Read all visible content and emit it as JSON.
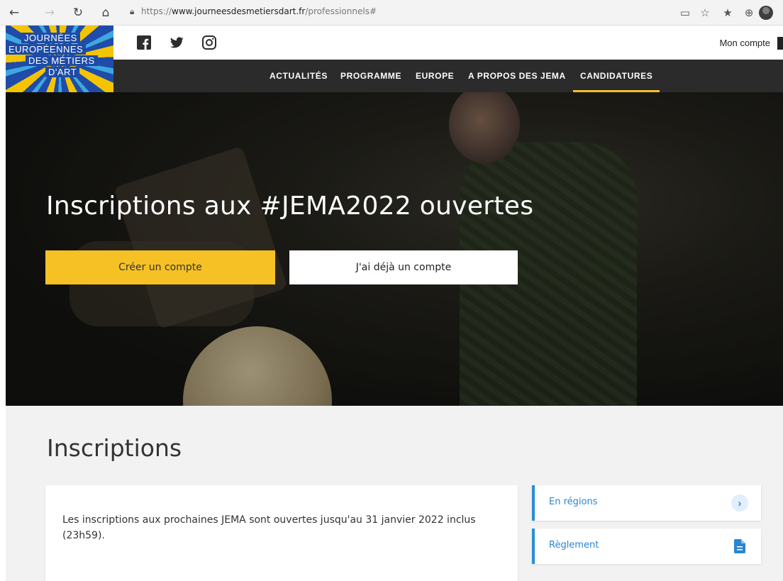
{
  "browser": {
    "url_prefix": "https://",
    "url_domain": "www.journeesdesmetiersdart.fr",
    "url_path": "/professionnels#"
  },
  "logo": {
    "line1": "JOURNÉES",
    "line2": "EUROPÉENNES",
    "line3": "DES MÉTIERS",
    "line4": "D'ART"
  },
  "header": {
    "account_label": "Mon compte"
  },
  "nav": {
    "items": [
      "ACTUALITÉS",
      "PROGRAMME",
      "EUROPE",
      "A PROPOS DES JEMA",
      "CANDIDATURES"
    ],
    "active": "CANDIDATURES"
  },
  "hero": {
    "title": "Inscriptions aux #JEMA2022 ouvertes",
    "primary_button": "Créer un compte",
    "secondary_button": "J'ai déjà un compte"
  },
  "inscriptions": {
    "title": "Inscriptions",
    "text": "Les inscriptions aux prochaines JEMA sont ouvertes jusqu'au 31 janvier 2022 inclus (23h59).",
    "side_links": [
      "En régions",
      "Règlement"
    ]
  },
  "colors": {
    "accent_yellow": "#f6c125",
    "link_blue": "#2a85cf",
    "nav_dark": "#2b2b2b"
  }
}
